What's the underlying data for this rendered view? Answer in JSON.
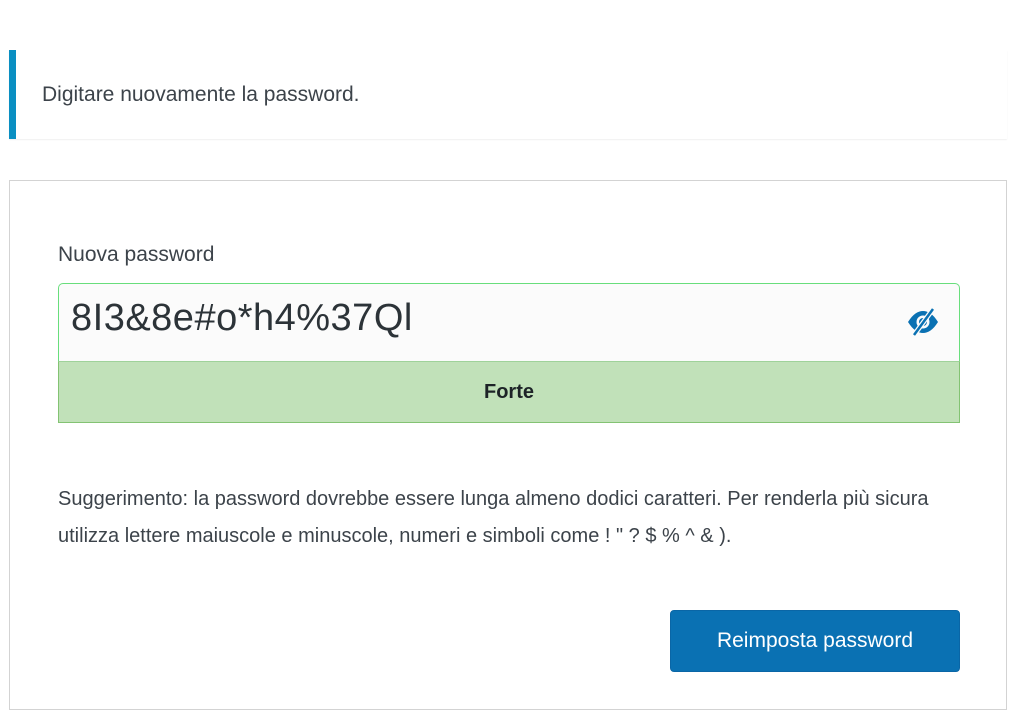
{
  "notice": {
    "message": "Digitare nuovamente la password."
  },
  "form": {
    "password_label": "Nuova password",
    "password_value": "8I3&8e#o*h4%37Ql",
    "toggle_icon": "eye-slash-icon",
    "strength_label": "Forte",
    "hint_text": "Suggerimento: la password dovrebbe essere lunga almeno dodici caratteri. Per renderla più sicura utilizza lettere maiuscole e minuscole, numeri e simboli come ! \" ? $ % ^ & ).",
    "submit_label": "Reimposta password"
  },
  "colors": {
    "notice_accent": "#0a8fc2",
    "strength_bg": "#c1e1b9",
    "strength_border": "#83c373",
    "button_bg": "#0a71b3"
  }
}
